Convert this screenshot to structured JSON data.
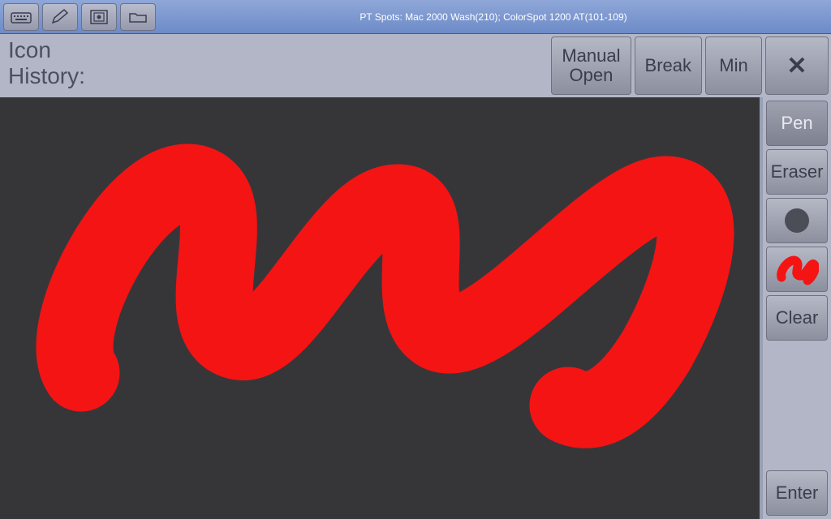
{
  "titlebar": {
    "text": "PT Spots: Mac 2000 Wash(210); ColorSpot 1200 AT(101-109)"
  },
  "header": {
    "icon_label": "Icon",
    "history_label": "History:",
    "buttons": {
      "manual_open_line1": "Manual",
      "manual_open_line2": "Open",
      "break": "Break",
      "min": "Min",
      "close_glyph": "✕"
    }
  },
  "sidebar": {
    "pen": "Pen",
    "eraser": "Eraser",
    "clear": "Clear",
    "enter": "Enter"
  },
  "colors": {
    "stroke": "#f41414",
    "canvas_bg": "#363639",
    "panel_bg": "#b2b6c6"
  }
}
